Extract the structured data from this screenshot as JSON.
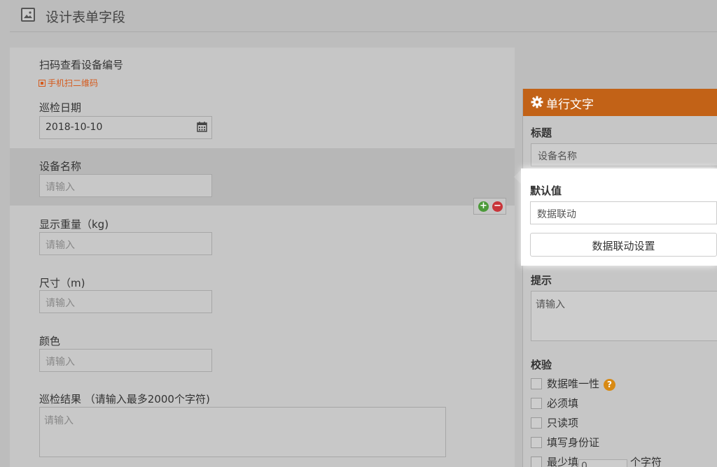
{
  "header": {
    "title": "设计表单字段",
    "icon": "image-icon"
  },
  "form": {
    "scan_label": "扫码查看设备编号",
    "scan_link": "手机扫二维码",
    "date_label": "巡检日期",
    "date_value": "2018-10-10",
    "device_label": "设备名称",
    "device_placeholder": "请输入",
    "weight_label": "显示重量（kg)",
    "weight_placeholder": "请输入",
    "size_label": "尺寸（m)",
    "size_placeholder": "请输入",
    "color_label": "颜色",
    "color_placeholder": "请输入",
    "result_label": "巡检结果 （请输入最多2000个字符)",
    "result_placeholder": "请输入",
    "add_symbol": "+",
    "remove_symbol": "−"
  },
  "panel": {
    "title": "单行文字",
    "title_label": "标题",
    "title_value": "设备名称",
    "default_label": "默认值",
    "default_value": "数据联动",
    "linkage_button": "数据联动设置",
    "hint_label": "提示",
    "hint_value": "请输入",
    "validation_label": "校验",
    "checks": {
      "unique": "数据唯一性",
      "required": "必须填",
      "readonly": "只读项",
      "idcard": "填写身份证",
      "min_prefix": "最少填",
      "min_value": "0",
      "min_suffix": "个字符"
    },
    "help_symbol": "?"
  },
  "colors": {
    "accent": "#c26217",
    "help": "#d88a14",
    "link": "#d55a1c"
  }
}
